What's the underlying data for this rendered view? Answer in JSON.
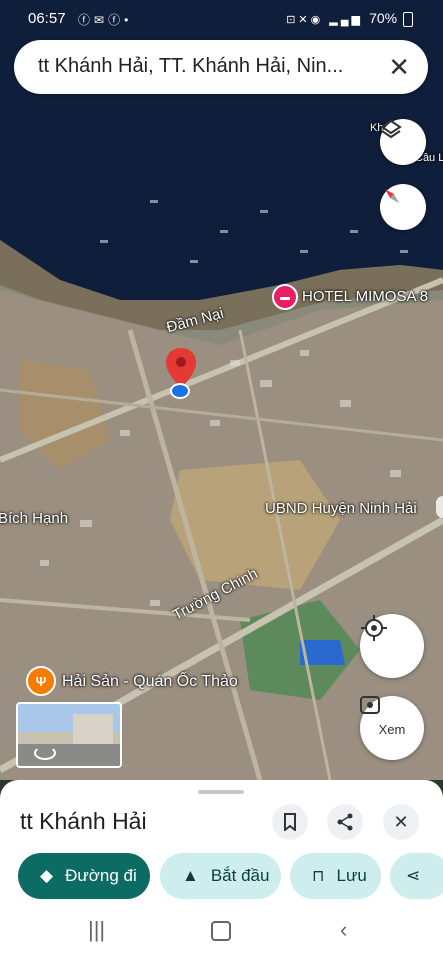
{
  "status_bar": {
    "time": "06:57",
    "notif_icons": [
      "facebook-icon",
      "mail-icon",
      "facebook-icon",
      "dot-icon"
    ],
    "right_text": "70%"
  },
  "search": {
    "query": "tt Khánh Hải, TT. Khánh Hải, Nin..."
  },
  "map": {
    "labels": {
      "hotel": "HOTEL MIMOSA 8",
      "dam_nai": "Đầm Nại",
      "ubnd": "UBND Huyện Ninh Hải",
      "bich_hanh": "Bích Hạnh",
      "truong_chinh": "Trường Chinh",
      "quan_oc": "Hải Sản - Quán Ốc Thảo",
      "edge_top": "Kh",
      "edge_top2": "Câu L"
    },
    "streetview_label": "Xem"
  },
  "sheet": {
    "title": "tt Khánh Hải",
    "chips": {
      "directions": "Đường đi",
      "start": "Bắt đầu",
      "save": "Lưu"
    }
  },
  "colors": {
    "primary": "#0c6b62",
    "chip_bg": "#cdeeed",
    "pin": "#e53935",
    "location": "#1a73e8"
  }
}
